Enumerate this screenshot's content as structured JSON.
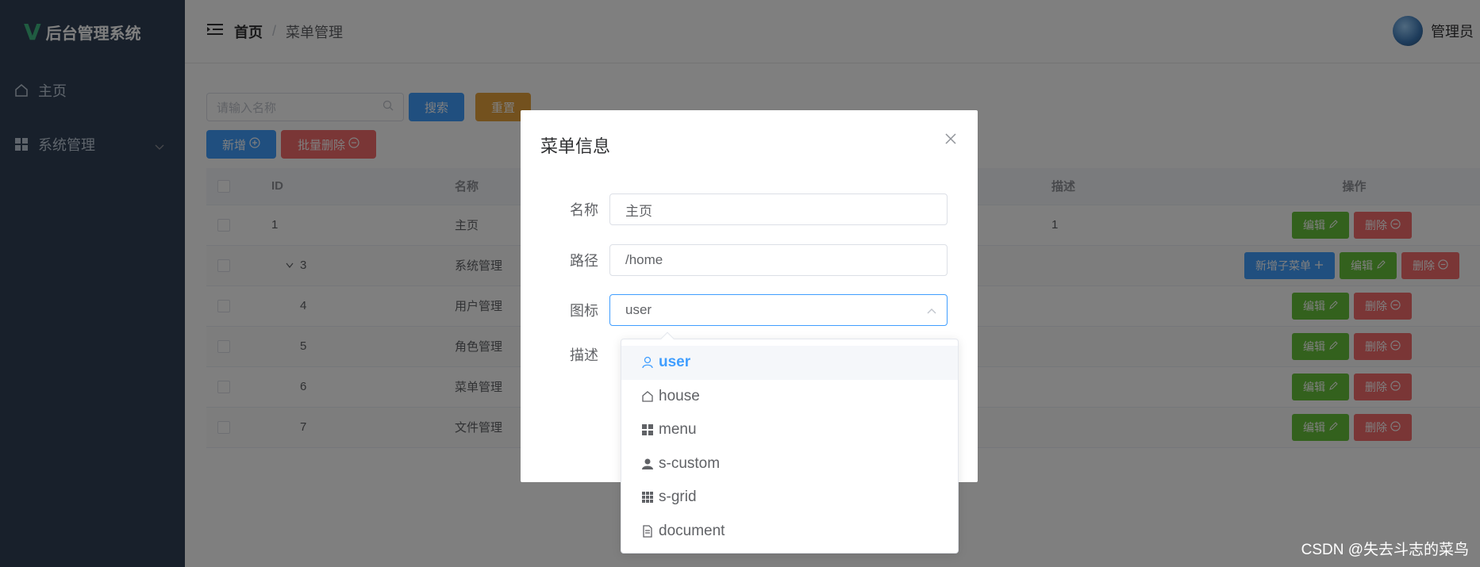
{
  "app": {
    "title": "后台管理系统"
  },
  "sidebar": {
    "items": [
      {
        "label": "主页",
        "icon": "house-icon"
      },
      {
        "label": "系统管理",
        "icon": "menu-grid-icon"
      }
    ]
  },
  "header": {
    "crumb_home": "首页",
    "crumb_sep": "/",
    "crumb_current": "菜单管理",
    "user_name": "管理员"
  },
  "toolbar": {
    "search_placeholder": "请输入名称",
    "search_label": "搜索",
    "reset_label": "重置",
    "add_label": "新增",
    "batch_delete_label": "批量删除"
  },
  "table": {
    "headers": {
      "id": "ID",
      "name": "名称",
      "desc": "描述",
      "actions": "操作"
    },
    "rows": [
      {
        "id": "1",
        "name": "主页",
        "desc": "1",
        "indent": 0,
        "expand": false,
        "add_child": false
      },
      {
        "id": "3",
        "name": "系统管理",
        "desc": "",
        "indent": 1,
        "expand": true,
        "add_child": true
      },
      {
        "id": "4",
        "name": "用户管理",
        "desc": "",
        "indent": 2,
        "expand": false,
        "add_child": false
      },
      {
        "id": "5",
        "name": "角色管理",
        "desc": "",
        "indent": 2,
        "expand": false,
        "add_child": false
      },
      {
        "id": "6",
        "name": "菜单管理",
        "desc": "",
        "indent": 2,
        "expand": false,
        "add_child": false
      },
      {
        "id": "7",
        "name": "文件管理",
        "desc": "",
        "indent": 2,
        "expand": false,
        "add_child": false
      }
    ],
    "edit_label": "编辑",
    "delete_label": "删除",
    "add_child_label": "新增子菜单"
  },
  "dialog": {
    "title": "菜单信息",
    "fields": {
      "name_label": "名称",
      "name_value": "主页",
      "path_label": "路径",
      "path_value": "/home",
      "icon_label": "图标",
      "icon_value": "user",
      "desc_label": "描述"
    }
  },
  "dropdown": {
    "options": [
      {
        "label": "user",
        "icon": "user-icon",
        "selected": true
      },
      {
        "label": "house",
        "icon": "house-icon",
        "selected": false
      },
      {
        "label": "menu",
        "icon": "menu-grid-icon",
        "selected": false
      },
      {
        "label": "s-custom",
        "icon": "person-solid-icon",
        "selected": false
      },
      {
        "label": "s-grid",
        "icon": "grid-icon",
        "selected": false
      },
      {
        "label": "document",
        "icon": "document-icon",
        "selected": false
      }
    ]
  },
  "watermark": "CSDN @失去斗志的菜鸟",
  "colors": {
    "sidebar_bg": "#304156",
    "primary": "#409eff",
    "success": "#67c23a",
    "danger": "#f56c6c",
    "warning": "#e6a23c"
  }
}
